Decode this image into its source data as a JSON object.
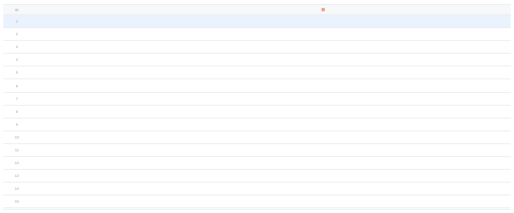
{
  "table": {
    "columns": {
      "id": "ID",
      "name": "",
      "attr": "",
      "type": "",
      "mask": "",
      "desc": ""
    },
    "rows": [
      {
        "id": "1",
        "name": "",
        "attr": "",
        "type": "",
        "mask": "",
        "selected": true
      },
      {
        "id": "2",
        "name": "",
        "attr": "",
        "type": "",
        "mask": ""
      },
      {
        "id": "3",
        "name": "",
        "attr": "",
        "type": "",
        "mask": ""
      },
      {
        "id": "4",
        "name": "",
        "attr": "",
        "type": "",
        "mask": ""
      },
      {
        "id": "5",
        "name": "",
        "attr": "",
        "type": "",
        "mask": ""
      },
      {
        "id": "6",
        "name": "",
        "attr": "",
        "type": "",
        "mask": ""
      },
      {
        "id": "7",
        "name": "",
        "attr": "",
        "type": "",
        "mask": ""
      },
      {
        "id": "8",
        "name": "",
        "attr": "",
        "type": "",
        "mask": ""
      },
      {
        "id": "9",
        "name": "",
        "attr": "",
        "type": "",
        "mask": ""
      },
      {
        "id": "10",
        "name": "",
        "attr": "",
        "type": "",
        "mask": ""
      },
      {
        "id": "11",
        "name": "",
        "attr": "",
        "type": "",
        "mask": ""
      },
      {
        "id": "12",
        "name": "",
        "attr": "",
        "type": "",
        "mask": ""
      },
      {
        "id": "13",
        "name": "",
        "attr": "",
        "type": "",
        "mask": ""
      },
      {
        "id": "14",
        "name": "",
        "attr": "",
        "type": "",
        "mask": ""
      },
      {
        "id": "15",
        "name": "",
        "attr": "",
        "type": "",
        "mask": ""
      }
    ]
  },
  "colors": {
    "header_bg": "#f7f8fa",
    "selected_row_bg": "#eaf3fd",
    "border": "#e8ebef",
    "help_icon": "#e25c4a"
  }
}
